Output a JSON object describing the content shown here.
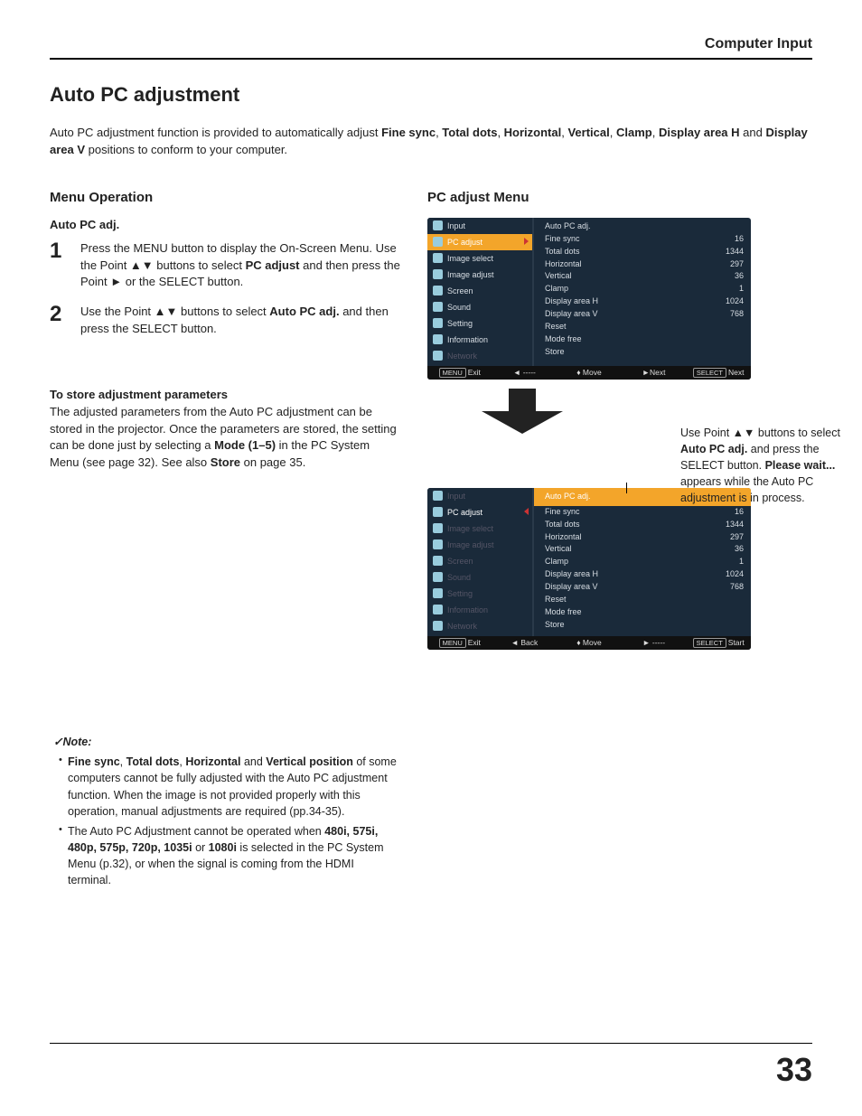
{
  "header": "Computer Input",
  "title": "Auto PC adjustment",
  "intro_parts": {
    "t1": "Auto PC adjustment function is provided to automatically adjust ",
    "b1": "Fine sync",
    "c1": ", ",
    "b2": "Total dots",
    "c2": ", ",
    "b3": "Horizontal",
    "c3": ", ",
    "b4": "Vertical",
    "c4": ", ",
    "b5": "Clamp",
    "c5": ", ",
    "b6": "Display area H",
    "c6": " and ",
    "b7": "Display area V",
    "t2": " positions to conform to your computer."
  },
  "left": {
    "h2": "Menu Operation",
    "sub": "Auto PC adj.",
    "step1": {
      "num": "1",
      "t1": "Press the MENU button to display the On-Screen Menu. Use the Point ▲▼ buttons to select ",
      "b1": "PC adjust",
      "t2": " and then press the Point ► or the SELECT button."
    },
    "step2": {
      "num": "2",
      "t1": "Use the Point ▲▼ buttons to select ",
      "b1": "Auto PC adj.",
      "t2": " and then press the SELECT button."
    },
    "store": {
      "title": "To store adjustment parameters",
      "t1": "The adjusted parameters from the Auto PC adjustment can be stored in the projector. Once the parameters are stored, the setting can be done just by selecting a ",
      "b1": "Mode (1–5)",
      "t2": " in the PC System Menu (see page 32). See also ",
      "b2": "Store",
      "t3": " on page 35."
    },
    "note": {
      "label": "✓Note:",
      "li1": {
        "b1": "Fine sync",
        "c1": ", ",
        "b2": "Total dots",
        "c2": ", ",
        "b3": "Horizontal",
        "c3": " and ",
        "b4": "Vertical position",
        "t": " of some computers cannot be fully adjusted with the Auto PC adjustment function. When the image is not provided properly with this operation, manual adjustments are required (pp.34-35)."
      },
      "li2": {
        "t1": "The Auto PC Adjustment cannot be operated when ",
        "b1": "480i, 575i, 480p, 575p, 720p, 1035i",
        "c1": " or ",
        "b2": "1080i",
        "t2": " is selected in the PC System Menu (p.32), or when the signal is coming from the HDMI terminal."
      }
    }
  },
  "right": {
    "h2": "PC adjust Menu",
    "instruction": {
      "t1": "Use Point ▲▼ buttons to select ",
      "b1": "Auto PC adj.",
      "t2": " and press the SELECT button. ",
      "b2": "Please wait...",
      "t3": " appears while the Auto PC adjustment is in process."
    }
  },
  "osd": {
    "side_items": [
      {
        "label": "Input",
        "dim": false
      },
      {
        "label": "PC adjust",
        "dim": false,
        "sel": true
      },
      {
        "label": "Image select",
        "dim": false
      },
      {
        "label": "Image adjust",
        "dim": false
      },
      {
        "label": "Screen",
        "dim": false
      },
      {
        "label": "Sound",
        "dim": false
      },
      {
        "label": "Setting",
        "dim": false
      },
      {
        "label": "Information",
        "dim": false
      },
      {
        "label": "Network",
        "dim": true
      }
    ],
    "side_items2": [
      {
        "label": "Input",
        "dim": true
      },
      {
        "label": "PC adjust",
        "dim": false,
        "sel": true,
        "red_left": true
      },
      {
        "label": "Image select",
        "dim": true
      },
      {
        "label": "Image adjust",
        "dim": true
      },
      {
        "label": "Screen",
        "dim": true
      },
      {
        "label": "Sound",
        "dim": true
      },
      {
        "label": "Setting",
        "dim": true
      },
      {
        "label": "Information",
        "dim": true
      },
      {
        "label": "Network",
        "dim": true
      }
    ],
    "main_rows": [
      {
        "k": "Auto PC adj.",
        "v": ""
      },
      {
        "k": "Fine sync",
        "v": "16"
      },
      {
        "k": "Total dots",
        "v": "1344"
      },
      {
        "k": "Horizontal",
        "v": "297"
      },
      {
        "k": "Vertical",
        "v": "36"
      },
      {
        "k": "Clamp",
        "v": "1"
      },
      {
        "k": "Display area H",
        "v": "1024"
      },
      {
        "k": "Display area V",
        "v": "768"
      },
      {
        "k": "Reset",
        "v": ""
      },
      {
        "k": "Mode free",
        "v": ""
      },
      {
        "k": "Store",
        "v": ""
      }
    ],
    "foot1": {
      "exit": "Exit",
      "back": "◄ -----",
      "move": "♦ Move",
      "next1": "►Next",
      "next2": "Next",
      "menu_btn": "MENU",
      "sel_btn": "SELECT"
    },
    "foot2": {
      "exit": "Exit",
      "back": "◄ Back",
      "move": "♦ Move",
      "next1": "► -----",
      "next2": "Start",
      "menu_btn": "MENU",
      "sel_btn": "SELECT"
    }
  },
  "page_num": "33"
}
